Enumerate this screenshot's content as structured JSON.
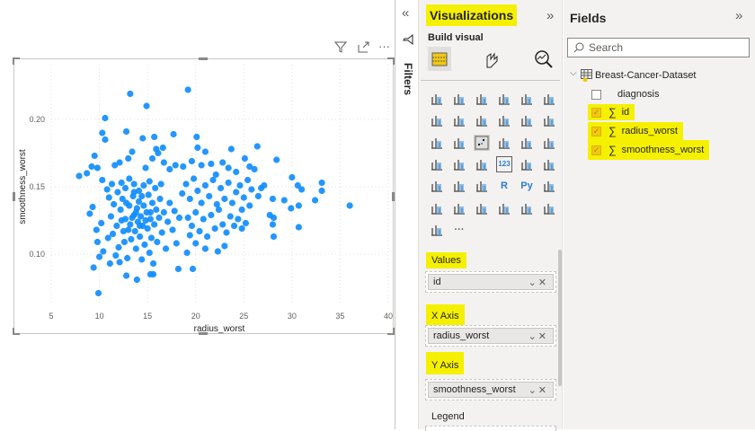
{
  "visual": {
    "header_icons": [
      "filter-icon",
      "focus-mode-icon",
      "more-options-icon"
    ],
    "more_label": "···"
  },
  "chart_data": {
    "type": "scatter",
    "title": "",
    "xlabel": "radius_worst",
    "ylabel": "smoothness_worst",
    "xlim": [
      5,
      40
    ],
    "ylim": [
      0.06,
      0.235
    ],
    "xticks": [
      "5",
      "10",
      "15",
      "20",
      "25",
      "30",
      "35",
      "40"
    ],
    "xtick_values": [
      5,
      10,
      15,
      20,
      25,
      30,
      35,
      40
    ],
    "yticks": [
      "0.10",
      "0.15",
      "0.20"
    ],
    "ytick_values": [
      0.1,
      0.15,
      0.2
    ],
    "grid": true,
    "color": "#118dff",
    "points": [
      [
        19.2,
        0.222
      ],
      [
        13.2,
        0.219
      ],
      [
        14.9,
        0.21
      ],
      [
        10.6,
        0.201
      ],
      [
        9.9,
        0.071
      ],
      [
        36.0,
        0.136
      ],
      [
        33.1,
        0.153
      ],
      [
        33.1,
        0.147
      ],
      [
        32.4,
        0.14
      ],
      [
        30.7,
        0.12
      ],
      [
        30.7,
        0.136
      ],
      [
        29.9,
        0.134
      ],
      [
        30.0,
        0.157
      ],
      [
        31.0,
        0.148
      ],
      [
        30.6,
        0.151
      ],
      [
        28.4,
        0.17
      ],
      [
        26.4,
        0.18
      ],
      [
        28.1,
        0.113
      ],
      [
        28.0,
        0.122
      ],
      [
        29.2,
        0.14
      ],
      [
        28.0,
        0.141
      ],
      [
        27.7,
        0.129
      ],
      [
        28.1,
        0.127
      ],
      [
        27.1,
        0.151
      ],
      [
        26.5,
        0.143
      ],
      [
        18.2,
        0.089
      ],
      [
        19.7,
        0.089
      ],
      [
        13.9,
        0.081
      ],
      [
        12.8,
        0.084
      ],
      [
        9.4,
        0.09
      ],
      [
        7.9,
        0.158
      ],
      [
        8.7,
        0.16
      ],
      [
        9.5,
        0.173
      ],
      [
        10.3,
        0.19
      ],
      [
        10.6,
        0.185
      ],
      [
        12.8,
        0.191
      ],
      [
        23.7,
        0.178
      ],
      [
        20.1,
        0.187
      ],
      [
        17.7,
        0.189
      ],
      [
        15.7,
        0.187
      ],
      [
        14.5,
        0.186
      ],
      [
        20.2,
        0.179
      ],
      [
        9.2,
        0.165
      ],
      [
        9.8,
        0.164
      ],
      [
        10.3,
        0.155
      ],
      [
        10.8,
        0.148
      ],
      [
        11.3,
        0.152
      ],
      [
        11.9,
        0.146
      ],
      [
        12.3,
        0.153
      ],
      [
        12.7,
        0.149
      ],
      [
        13.1,
        0.156
      ],
      [
        13.6,
        0.152
      ],
      [
        14.1,
        0.147
      ],
      [
        14.6,
        0.151
      ],
      [
        15.2,
        0.154
      ],
      [
        15.8,
        0.149
      ],
      [
        16.4,
        0.152
      ],
      [
        11.6,
        0.166
      ],
      [
        12.1,
        0.168
      ],
      [
        13.4,
        0.176
      ],
      [
        13.0,
        0.171
      ],
      [
        14.8,
        0.164
      ],
      [
        15.5,
        0.171
      ],
      [
        16.1,
        0.175
      ],
      [
        16.7,
        0.168
      ],
      [
        17.3,
        0.163
      ],
      [
        17.9,
        0.166
      ],
      [
        16.6,
        0.179
      ],
      [
        15.9,
        0.178
      ],
      [
        9.3,
        0.135
      ],
      [
        9.0,
        0.13
      ],
      [
        9.7,
        0.118
      ],
      [
        10.2,
        0.123
      ],
      [
        9.8,
        0.109
      ],
      [
        10.4,
        0.102
      ],
      [
        10.0,
        0.098
      ],
      [
        10.9,
        0.112
      ],
      [
        11.2,
        0.128
      ],
      [
        11.5,
        0.137
      ],
      [
        11.8,
        0.121
      ],
      [
        12.0,
        0.105
      ],
      [
        12.2,
        0.133
      ],
      [
        12.4,
        0.141
      ],
      [
        12.5,
        0.117
      ],
      [
        12.7,
        0.126
      ],
      [
        12.9,
        0.097
      ],
      [
        13.1,
        0.136
      ],
      [
        13.2,
        0.122
      ],
      [
        13.3,
        0.111
      ],
      [
        13.5,
        0.143
      ],
      [
        13.6,
        0.129
      ],
      [
        13.7,
        0.117
      ],
      [
        13.8,
        0.104
      ],
      [
        13.9,
        0.134
      ],
      [
        14.0,
        0.124
      ],
      [
        14.1,
        0.139
      ],
      [
        14.2,
        0.113
      ],
      [
        14.3,
        0.128
      ],
      [
        14.4,
        0.096
      ],
      [
        14.5,
        0.121
      ],
      [
        14.6,
        0.136
      ],
      [
        14.7,
        0.107
      ],
      [
        14.9,
        0.131
      ],
      [
        15.0,
        0.119
      ],
      [
        15.1,
        0.144
      ],
      [
        15.2,
        0.101
      ],
      [
        15.3,
        0.126
      ],
      [
        15.4,
        0.112
      ],
      [
        15.5,
        0.138
      ],
      [
        15.6,
        0.093
      ],
      [
        15.7,
        0.122
      ],
      [
        15.9,
        0.133
      ],
      [
        16.0,
        0.109
      ],
      [
        16.2,
        0.127
      ],
      [
        16.3,
        0.141
      ],
      [
        16.5,
        0.116
      ],
      [
        16.7,
        0.131
      ],
      [
        16.9,
        0.104
      ],
      [
        17.1,
        0.124
      ],
      [
        17.3,
        0.138
      ],
      [
        17.6,
        0.118
      ],
      [
        17.8,
        0.132
      ],
      [
        18.0,
        0.108
      ],
      [
        18.3,
        0.127
      ],
      [
        11.0,
        0.142
      ],
      [
        11.4,
        0.115
      ],
      [
        11.7,
        0.099
      ],
      [
        12.6,
        0.109
      ],
      [
        13.0,
        0.118
      ],
      [
        13.4,
        0.127
      ],
      [
        13.8,
        0.131
      ],
      [
        14.2,
        0.121
      ],
      [
        14.8,
        0.125
      ],
      [
        15.3,
        0.131
      ],
      [
        12.3,
        0.125
      ],
      [
        12.8,
        0.138
      ],
      [
        13.6,
        0.146
      ],
      [
        14.4,
        0.143
      ],
      [
        11.1,
        0.093
      ],
      [
        12.1,
        0.094
      ],
      [
        15.3,
        0.085
      ],
      [
        15.6,
        0.085
      ],
      [
        18.6,
        0.145
      ],
      [
        19.0,
        0.152
      ],
      [
        19.4,
        0.141
      ],
      [
        19.8,
        0.156
      ],
      [
        20.2,
        0.147
      ],
      [
        20.6,
        0.138
      ],
      [
        21.0,
        0.151
      ],
      [
        21.4,
        0.143
      ],
      [
        21.8,
        0.155
      ],
      [
        22.2,
        0.137
      ],
      [
        22.6,
        0.149
      ],
      [
        23.0,
        0.141
      ],
      [
        23.4,
        0.153
      ],
      [
        23.8,
        0.138
      ],
      [
        24.2,
        0.146
      ],
      [
        24.6,
        0.151
      ],
      [
        25.0,
        0.142
      ],
      [
        25.4,
        0.155
      ],
      [
        25.8,
        0.148
      ],
      [
        19.2,
        0.127
      ],
      [
        19.6,
        0.121
      ],
      [
        20.0,
        0.131
      ],
      [
        20.4,
        0.117
      ],
      [
        20.8,
        0.126
      ],
      [
        21.2,
        0.113
      ],
      [
        21.6,
        0.129
      ],
      [
        22.0,
        0.119
      ],
      [
        22.4,
        0.133
      ],
      [
        22.8,
        0.122
      ],
      [
        23.2,
        0.116
      ],
      [
        23.6,
        0.128
      ],
      [
        24.0,
        0.121
      ],
      [
        24.4,
        0.126
      ],
      [
        24.8,
        0.119
      ],
      [
        25.2,
        0.123
      ],
      [
        19.4,
        0.114
      ],
      [
        20.0,
        0.108
      ],
      [
        21.0,
        0.104
      ],
      [
        22.3,
        0.102
      ],
      [
        23.0,
        0.106
      ],
      [
        19.1,
        0.101
      ],
      [
        18.7,
        0.165
      ],
      [
        19.6,
        0.169
      ],
      [
        20.6,
        0.166
      ],
      [
        21.6,
        0.167
      ],
      [
        22.8,
        0.168
      ],
      [
        23.4,
        0.164
      ],
      [
        24.2,
        0.161
      ],
      [
        25.1,
        0.171
      ],
      [
        25.6,
        0.165
      ],
      [
        26.1,
        0.163
      ],
      [
        21.0,
        0.176
      ],
      [
        22.1,
        0.159
      ],
      [
        24.8,
        0.133
      ],
      [
        25.6,
        0.136
      ],
      [
        26.8,
        0.149
      ]
    ]
  },
  "filters": {
    "label": "Filters",
    "collapse_icon": "«"
  },
  "visualizations": {
    "title": "Visualizations",
    "expand": "»",
    "build_visual": "Build visual",
    "wells": [
      {
        "label": "Values",
        "value": "id"
      },
      {
        "label": "X Axis",
        "value": "radius_worst"
      },
      {
        "label": "Y Axis",
        "value": "smoothness_worst"
      },
      {
        "label": "Legend"
      }
    ],
    "icon_glyphs": {
      "r": "R",
      "py": "Py",
      "card": "123",
      "more": "···"
    }
  },
  "fields": {
    "title": "Fields",
    "expand": "»",
    "search_placeholder": "Search",
    "dataset": "Breast-Cancer-Dataset",
    "items": [
      {
        "name": "diagnosis",
        "checked": false
      },
      {
        "name": "id",
        "checked": true,
        "sigma": "∑"
      },
      {
        "name": "radius_worst",
        "checked": true,
        "sigma": "∑"
      },
      {
        "name": "smoothness_worst",
        "checked": true,
        "sigma": "∑"
      }
    ],
    "check": "✓"
  }
}
